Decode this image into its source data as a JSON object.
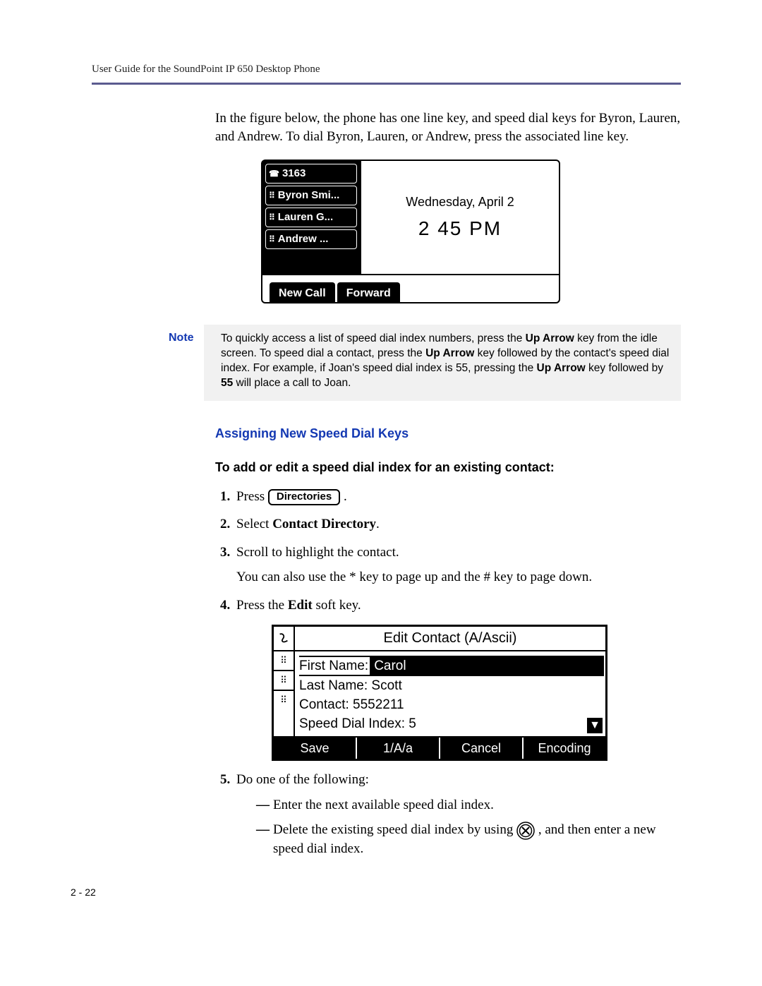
{
  "header": {
    "running": "User Guide for the SoundPoint IP 650 Desktop Phone"
  },
  "intro": "In the figure below, the phone has one line key, and speed dial keys for Byron, Lauren, and Andrew. To dial Byron, Lauren, or Andrew, press the associated line key.",
  "phone": {
    "line_number": "3163",
    "keys": [
      "Byron Smi...",
      "Lauren G...",
      "Andrew ..."
    ],
    "date": "Wednesday, April 2",
    "time": "2 45 PM",
    "softkeys": [
      "New Call",
      "Forward"
    ]
  },
  "note": {
    "label": "Note",
    "pre": "To quickly access a list of speed dial index numbers, press the ",
    "k1": "Up Arrow",
    "mid1": " key from the idle screen. To speed dial a contact, press the ",
    "k2": "Up Arrow",
    "mid2": " key followed by the contact's speed dial index. For example, if Joan's speed dial index is 55, pressing the ",
    "k3": "Up Arrow",
    "mid3": " key followed by ",
    "k4": "55",
    "post": " will place a call to Joan."
  },
  "h3": "Assigning New Speed Dial Keys",
  "h4": "To add or edit a speed dial index for an existing contact:",
  "steps": {
    "s1_pre": "Press ",
    "s1_btn": "Directories",
    "s1_post": " .",
    "s2_pre": "Select ",
    "s2_b": "Contact Directory",
    "s2_post": ".",
    "s3a": "Scroll to highlight the contact.",
    "s3b": "You can also use the * key to page up and the # key to page down.",
    "s4_pre": "Press the ",
    "s4_b": "Edit",
    "s4_post": " soft key.",
    "s5": "Do one of the following:",
    "s5a": "Enter the next available speed dial index.",
    "s5b_pre": "Delete the existing speed dial index by using ",
    "s5b_post": ", and then enter a new speed dial index."
  },
  "edit": {
    "title": "Edit Contact (A/Ascii)",
    "fn_label": "First Name:",
    "fn_val": "Carol",
    "ln": "Last Name: Scott",
    "contact": "Contact: 5552211",
    "sdi": "Speed Dial Index: 5",
    "softkeys": [
      "Save",
      "1/A/a",
      "Cancel",
      "Encoding"
    ]
  },
  "pagenum": "2 - 22"
}
